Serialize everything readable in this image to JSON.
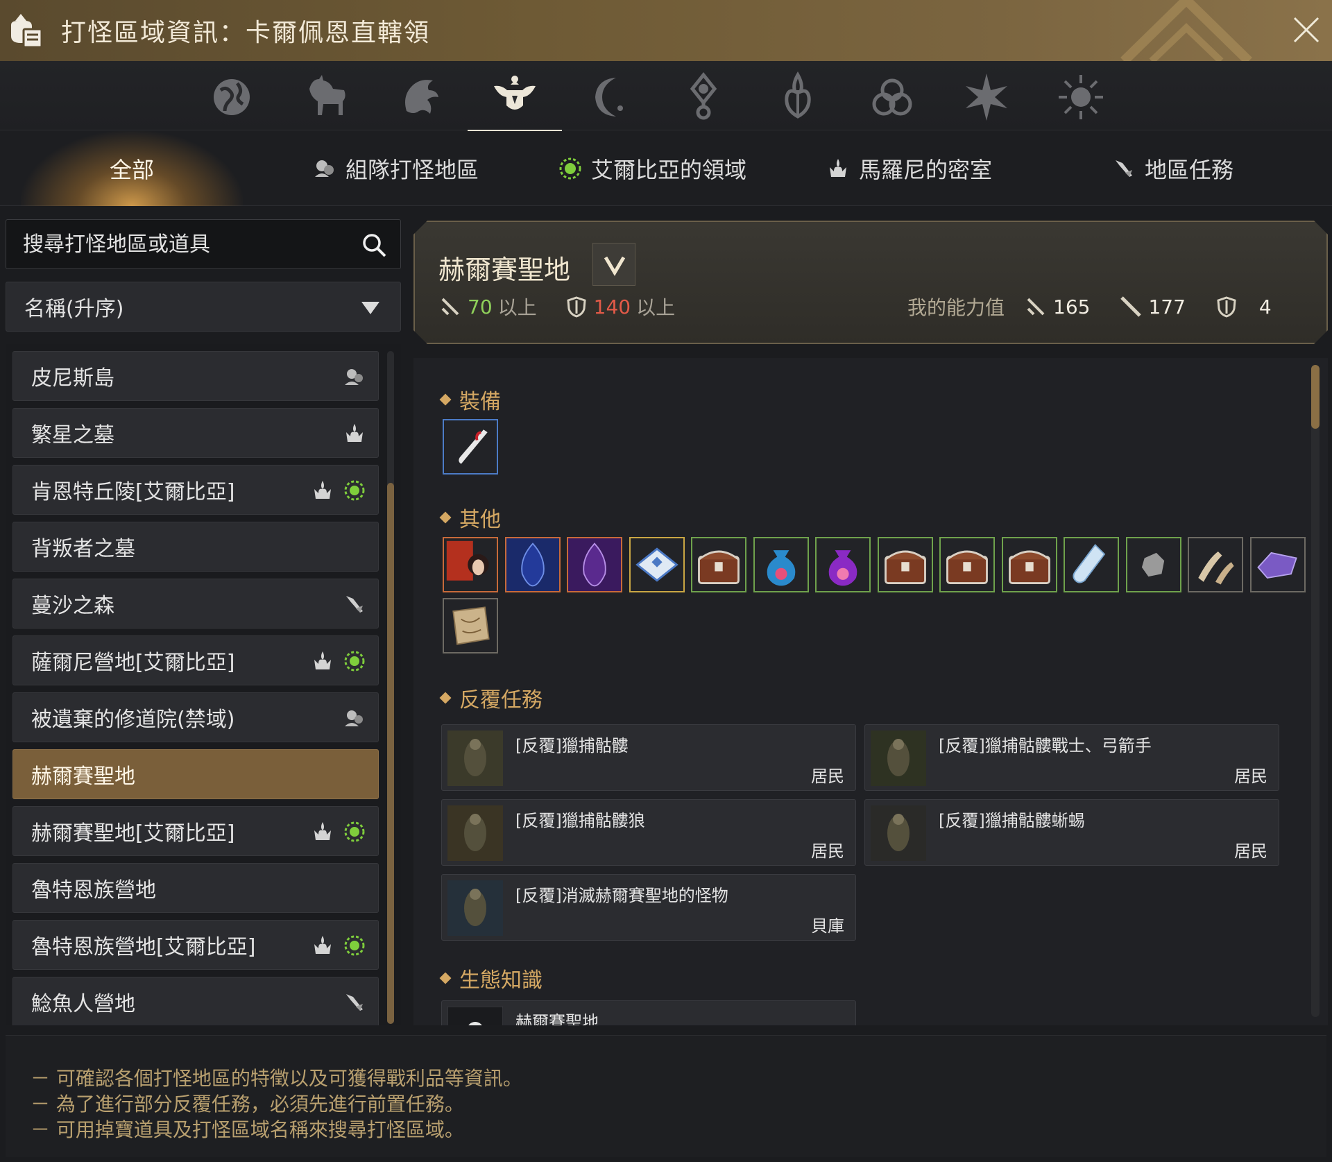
{
  "window": {
    "title": "打怪區域資訊：卡爾佩恩直轄領"
  },
  "region_icons": [
    {
      "icon": "globe-icon"
    },
    {
      "icon": "horse-icon"
    },
    {
      "icon": "dragon-icon"
    },
    {
      "icon": "winged-crest-icon",
      "active": true
    },
    {
      "icon": "crescent-moon-icon"
    },
    {
      "icon": "compass-orb-icon"
    },
    {
      "icon": "flame-crest-icon"
    },
    {
      "icon": "triquetra-icon"
    },
    {
      "icon": "star-burst-icon"
    },
    {
      "icon": "sun-icon"
    }
  ],
  "tabs": [
    {
      "label": "全部",
      "icon": ""
    },
    {
      "label": "組隊打怪地區",
      "icon": "party-icon"
    },
    {
      "label": "艾爾比亞的領域",
      "icon": "green-sun-icon"
    },
    {
      "label": "馬羅尼的密室",
      "icon": "crown-flame-icon"
    },
    {
      "label": "地區任務",
      "icon": "quest-arrow-icon"
    }
  ],
  "search": {
    "placeholder": "搜尋打怪地區或道具"
  },
  "sort": {
    "selected": "名稱(升序)"
  },
  "zone_list": [
    {
      "name": "皮尼斯島",
      "icons": [
        "party-icon"
      ]
    },
    {
      "name": "繁星之墓",
      "icons": [
        "crown-flame-icon"
      ]
    },
    {
      "name": "肯恩特丘陵[艾爾比亞]",
      "icons": [
        "crown-flame-icon",
        "green-sun-icon"
      ]
    },
    {
      "name": "背叛者之墓",
      "icons": []
    },
    {
      "name": "蔓沙之森",
      "icons": [
        "quest-arrow-icon"
      ]
    },
    {
      "name": "薩爾尼營地[艾爾比亞]",
      "icons": [
        "crown-flame-icon",
        "green-sun-icon"
      ]
    },
    {
      "name": "被遺棄的修道院(禁域)",
      "icons": [
        "party-icon"
      ]
    },
    {
      "name": "赫爾賽聖地",
      "icons": [],
      "selected": true
    },
    {
      "name": "赫爾賽聖地[艾爾比亞]",
      "icons": [
        "crown-flame-icon",
        "green-sun-icon"
      ]
    },
    {
      "name": "魯特恩族營地",
      "icons": []
    },
    {
      "name": "魯特恩族營地[艾爾比亞]",
      "icons": [
        "crown-flame-icon",
        "green-sun-icon"
      ]
    },
    {
      "name": "鯰魚人營地",
      "icons": [
        "quest-arrow-icon"
      ]
    }
  ],
  "zone_detail": {
    "name": "赫爾賽聖地",
    "req_ap": "70",
    "req_ap_suffix": "以上",
    "req_dp": "140",
    "req_dp_suffix": "以上",
    "my_stats_label": "我的能力值",
    "my_ap": "165",
    "my_awk_ap": "177",
    "my_dp": "4"
  },
  "sections": {
    "equipment": "裝備",
    "other": "其他",
    "repeat_quests": "反覆任務",
    "ecology": "生態知識"
  },
  "equipment_items": [
    {
      "icon": "feather-dagger-icon",
      "grade": "blue"
    }
  ],
  "other_items": [
    {
      "icon": "portrait-scroll-icon",
      "grade": "orange"
    },
    {
      "icon": "blue-crystal-icon",
      "grade": "orange"
    },
    {
      "icon": "purple-crystal-icon",
      "grade": "orange"
    },
    {
      "icon": "blue-stone-icon",
      "grade": "yellow"
    },
    {
      "icon": "treasure-chest-icon",
      "grade": "green"
    },
    {
      "icon": "blue-pouch-icon",
      "grade": "green"
    },
    {
      "icon": "purple-pouch-icon",
      "grade": "green"
    },
    {
      "icon": "treasure-chest-icon",
      "grade": "green"
    },
    {
      "icon": "treasure-chest-icon",
      "grade": "green"
    },
    {
      "icon": "treasure-chest-icon",
      "grade": "green"
    },
    {
      "icon": "potion-vial-icon",
      "grade": "green"
    },
    {
      "icon": "gray-ore-icon",
      "grade": "green"
    },
    {
      "icon": "bone-fragments-icon",
      "grade": "plain"
    },
    {
      "icon": "purple-gem-icon",
      "grade": "plain"
    },
    {
      "icon": "map-scroll-icon",
      "grade": "plain"
    }
  ],
  "repeat_quests": [
    {
      "name": "[反覆]獵捕骷髏",
      "type": "居民"
    },
    {
      "name": "[反覆]獵捕骷髏戰士、弓箭手",
      "type": "居民"
    },
    {
      "name": "[反覆]獵捕骷髏狼",
      "type": "居民"
    },
    {
      "name": "[反覆]獵捕骷髏蜥蜴",
      "type": "居民"
    },
    {
      "name": "[反覆]消滅赫爾賽聖地的怪物",
      "type": "貝庫"
    }
  ],
  "ecology": [
    {
      "name": "赫爾賽聖地"
    }
  ],
  "footer": {
    "lines": [
      "－ 可確認各個打怪地區的特徵以及可獲得戰利品等資訊。",
      "－ 為了進行部分反覆任務，必須先進行前置任務。",
      "－ 可用掉寶道具及打怪區域名稱來搜尋打怪區域。"
    ]
  },
  "colors": {
    "accent": "#d5a863",
    "selected_bg": "#7a5f3a",
    "green_stat": "#8fd05a",
    "red_stat": "#e25a48"
  }
}
